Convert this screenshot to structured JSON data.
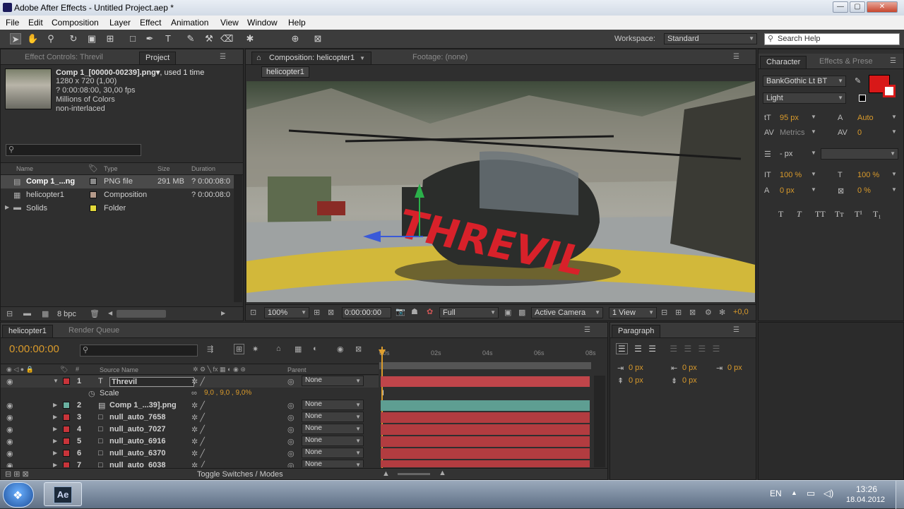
{
  "window": {
    "title": "Adobe After Effects - Untitled Project.aep *",
    "min": "—",
    "max": "▢",
    "close": "✕"
  },
  "menu": [
    "File",
    "Edit",
    "Composition",
    "Layer",
    "Effect",
    "Animation",
    "View",
    "Window",
    "Help"
  ],
  "workspace": {
    "label": "Workspace:",
    "value": "Standard"
  },
  "search_help": "Search Help",
  "project_panel": {
    "tabs": [
      "Effect Controls: Threvil",
      "Project"
    ],
    "info": {
      "name": "Comp 1_[00000-00239].png▾",
      "used": ", used 1 time",
      "dims": "1280 x 720 (1,00)",
      "duration": "? 0:00:08:00, 30,00 fps",
      "colors": "Millions of Colors",
      "interlace": "non-interlaced"
    },
    "columns": [
      "Name",
      "Type",
      "Size",
      "Duration"
    ],
    "items": [
      {
        "name": "Comp 1_...ng",
        "type": "PNG file",
        "size": "291 MB",
        "duration": "? 0:00:08:0",
        "label_color": "#8a8a8a"
      },
      {
        "name": "helicopter1",
        "type": "Composition",
        "size": "",
        "duration": "? 0:00:08:0",
        "label_color": "#b59a8a"
      },
      {
        "name": "Solids",
        "type": "Folder",
        "size": "",
        "duration": "",
        "label_color": "#e3d93a"
      }
    ],
    "bpc": "8 bpc"
  },
  "composition_panel": {
    "tabs": [
      "Composition: helicopter1",
      "Footage: (none)"
    ],
    "breadcrumb": "helicopter1",
    "overlay_text": "THREVIL",
    "zoom": "100%",
    "timecode": "0:00:00:00",
    "resolution": "Full",
    "camera": "Active Camera",
    "views": "1 View",
    "exposure": "+0,0"
  },
  "character_panel": {
    "tabs": [
      "Character",
      "Effects & Prese"
    ],
    "font": "BankGothic Lt BT",
    "style": "Light",
    "size": "95 px",
    "leading": "Auto",
    "kerning": "Metrics",
    "tracking": "0",
    "stroke": "- px",
    "vscale": "100 %",
    "hscale": "100 %",
    "baseline": "0 px",
    "tsume": "0 %",
    "fill_color": "#d81818",
    "styles": [
      "T",
      "T",
      "TT",
      "Tт",
      "T¹",
      "T₁"
    ]
  },
  "timeline": {
    "tabs": [
      "helicopter1",
      "Render Queue"
    ],
    "timecode": "0:00:00:00",
    "col_source": "Source Name",
    "col_parent": "Parent",
    "ruler": [
      "00s",
      "02s",
      "04s",
      "06s",
      "08s"
    ],
    "layers": [
      {
        "num": "1",
        "name": "Threvil",
        "type": "T",
        "color": "#c8343a",
        "parent": "None",
        "bar": "#c0454a"
      },
      {
        "num": "2",
        "name": "Comp 1_...39].png",
        "type": "img",
        "color": "#6ab0a0",
        "parent": "None",
        "bar": "#5e9e92"
      },
      {
        "num": "3",
        "name": "null_auto_7658",
        "type": "null",
        "color": "#c8343a",
        "parent": "None",
        "bar": "#b23c40"
      },
      {
        "num": "4",
        "name": "null_auto_7027",
        "type": "null",
        "color": "#c8343a",
        "parent": "None",
        "bar": "#b23c40"
      },
      {
        "num": "5",
        "name": "null_auto_6916",
        "type": "null",
        "color": "#c8343a",
        "parent": "None",
        "bar": "#b23c40"
      },
      {
        "num": "6",
        "name": "null_auto_6370",
        "type": "null",
        "color": "#c8343a",
        "parent": "None",
        "bar": "#b23c40"
      },
      {
        "num": "7",
        "name": "null_auto_6038",
        "type": "null",
        "color": "#c8343a",
        "parent": "None",
        "bar": "#b23c40"
      }
    ],
    "scale_label": "Scale",
    "scale_value": "9,0 , 9,0 , 9,0%",
    "toggle": "Toggle Switches / Modes"
  },
  "paragraph_panel": {
    "tab": "Paragraph",
    "vals": [
      "0 px",
      "0 px",
      "0 px",
      "0 px",
      "0 px"
    ]
  },
  "taskbar": {
    "app": "Ae",
    "lang": "EN",
    "time": "13:26",
    "date": "18.04.2012"
  }
}
